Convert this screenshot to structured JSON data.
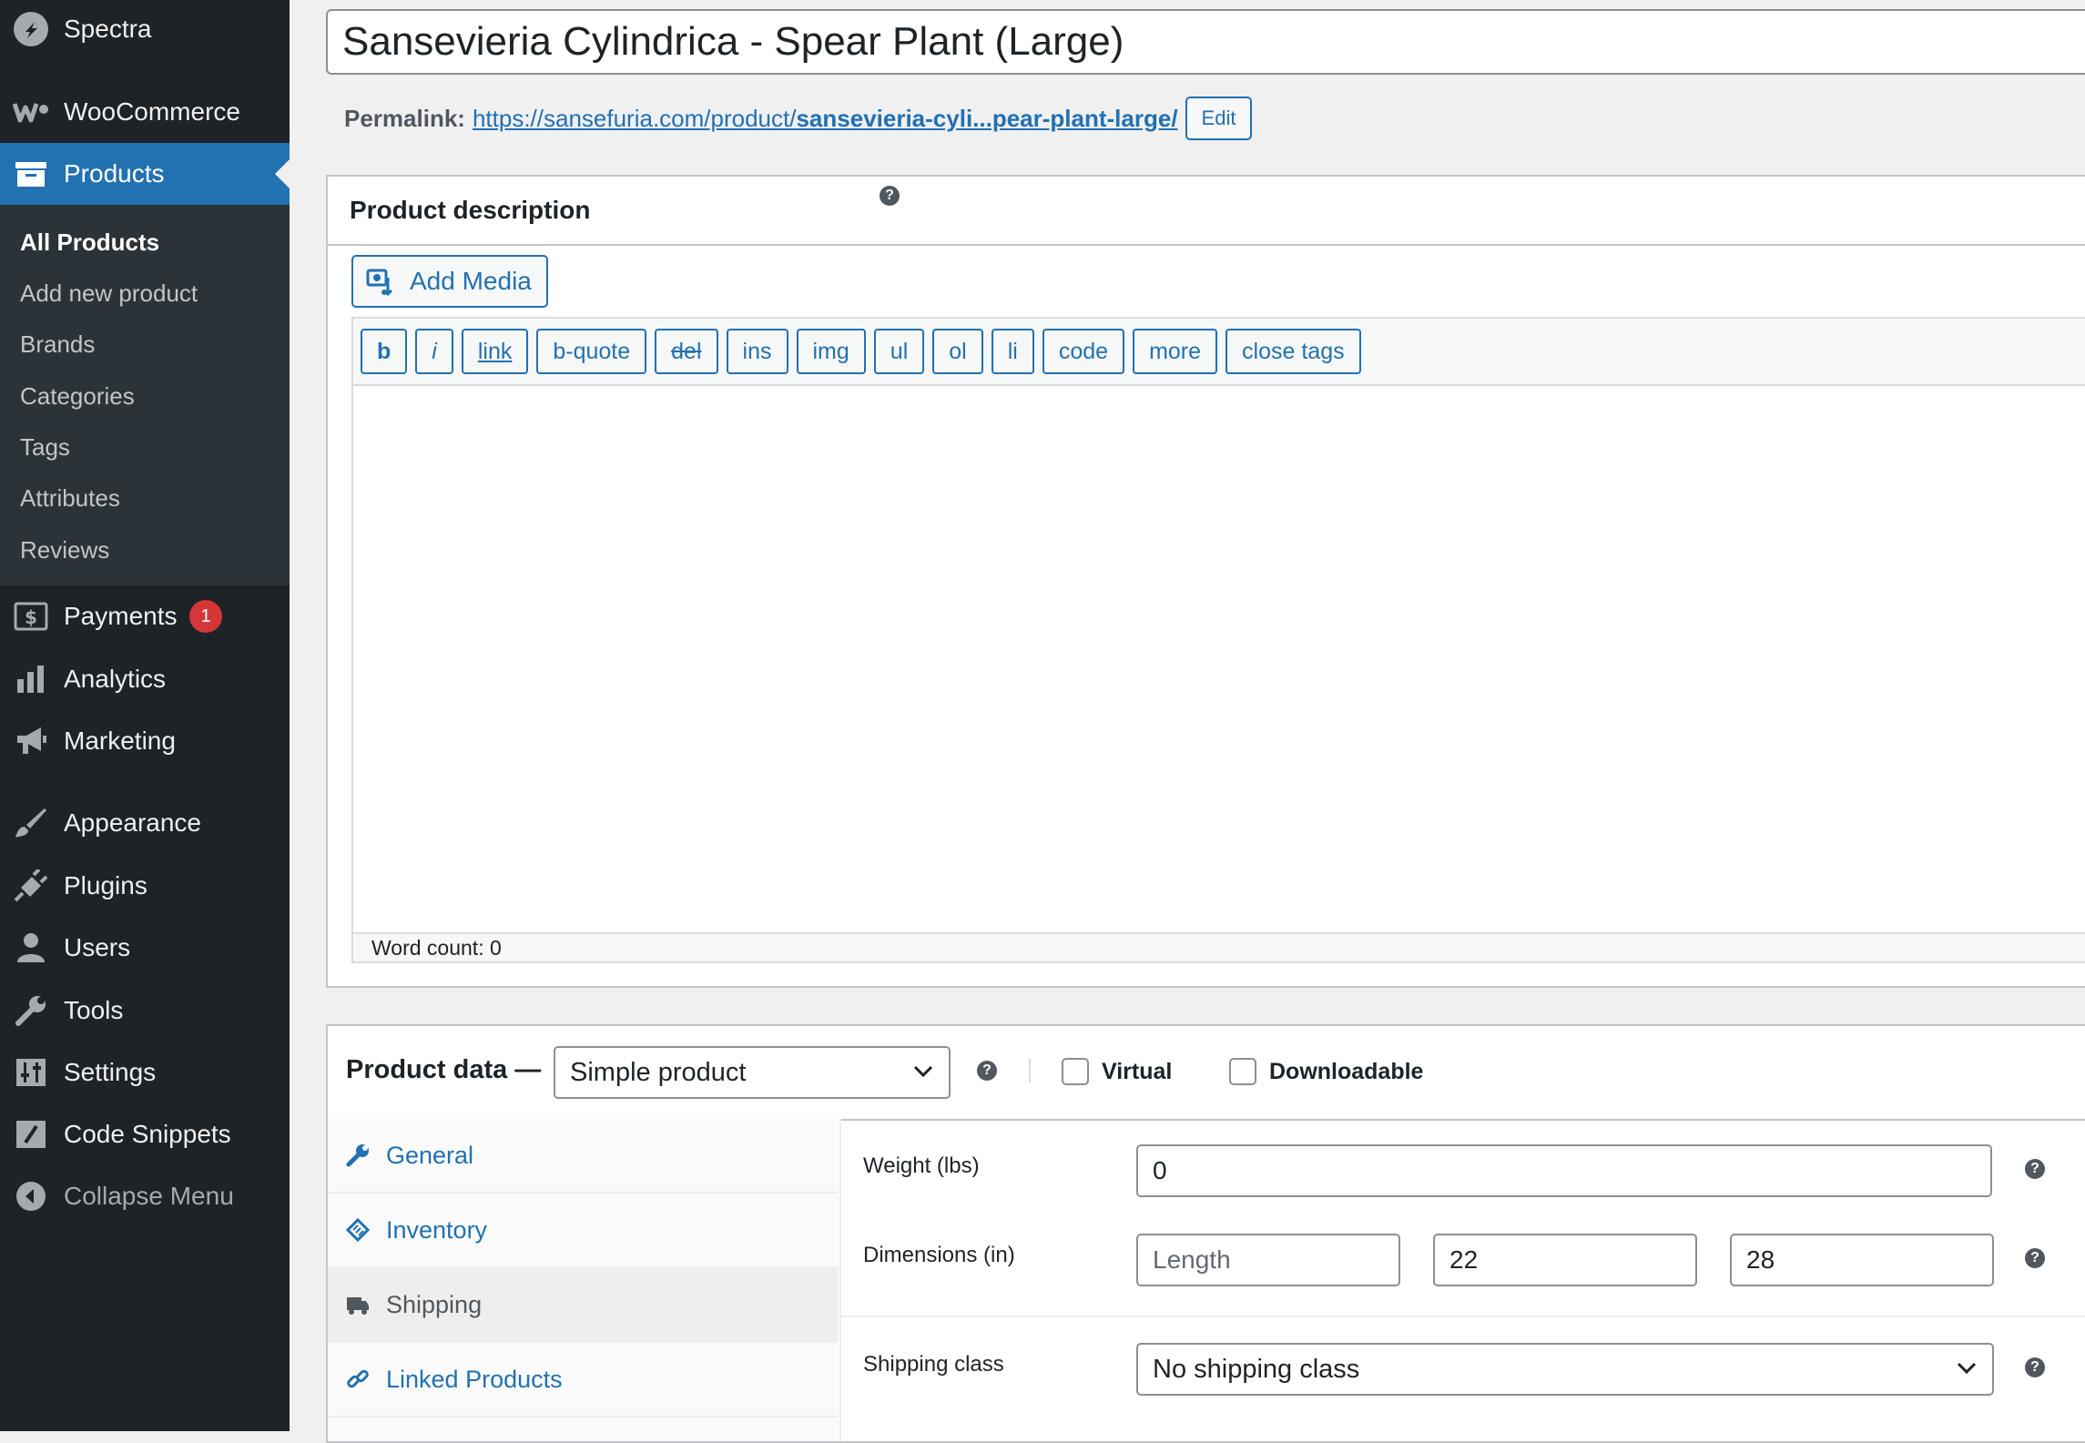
{
  "sidebar": {
    "site_name": "Spectra",
    "woocommerce": "WooCommerce",
    "products": "Products",
    "submenu": [
      "All Products",
      "Add new product",
      "Brands",
      "Categories",
      "Tags",
      "Attributes",
      "Reviews"
    ],
    "payments": "Payments",
    "payments_badge": "1",
    "analytics": "Analytics",
    "marketing": "Marketing",
    "appearance": "Appearance",
    "plugins": "Plugins",
    "users": "Users",
    "tools": "Tools",
    "settings": "Settings",
    "code_snippets": "Code Snippets",
    "collapse": "Collapse Menu"
  },
  "post": {
    "title": "Sansevieria Cylindrica - Spear Plant (Large)",
    "permalink_label": "Permalink:",
    "permalink_base": "https://sansefuria.com/product/",
    "permalink_slug": "sansevieria-cyli...pear-plant-large/",
    "edit_label": "Edit"
  },
  "description": {
    "heading": "Product description",
    "add_media": "Add Media",
    "help": "?",
    "quicktags": [
      "b",
      "i",
      "link",
      "b-quote",
      "del",
      "ins",
      "img",
      "ul",
      "ol",
      "li",
      "code",
      "more",
      "close tags"
    ],
    "word_count": "Word count: 0"
  },
  "product_data": {
    "heading": "Product data —",
    "type_value": "Simple product",
    "virtual_label": "Virtual",
    "downloadable_label": "Downloadable",
    "tabs": [
      "General",
      "Inventory",
      "Shipping",
      "Linked Products"
    ],
    "active_tab": "Shipping",
    "weight_label": "Weight (lbs)",
    "weight_value": "0",
    "dimensions_label": "Dimensions (in)",
    "length_placeholder": "Length",
    "width_value": "22",
    "height_value": "28",
    "shipping_class_label": "Shipping class",
    "shipping_class_value": "No shipping class"
  },
  "colors": {
    "accent": "#2271b1",
    "sidebar_bg": "#1d2327",
    "submenu_bg": "#2c3338",
    "badge": "#d63638"
  }
}
